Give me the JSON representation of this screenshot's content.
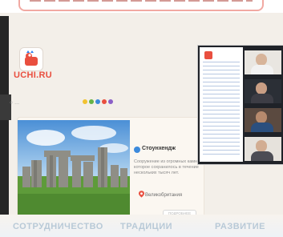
{
  "brand": {
    "name": "UCHI.RU",
    "color": "#e94f3f"
  },
  "header": {
    "left_faint": "○ ..."
  },
  "card": {
    "title": "Стоунхендж",
    "description": "Сооружение из огромных камней, которое сохранилось в течение нескольких тысяч лет.",
    "location": "Великобритания",
    "button": "ПОДРОБНЕЕ",
    "location_icon": "pin-icon"
  },
  "bottom_banner": {
    "words": [
      "СОТРУДНИЧЕСТВО",
      "ТРАДИЦИИ",
      "РАЗВИТИЕ"
    ]
  },
  "video_call": {
    "participants": 4
  },
  "colors": {
    "accent": "#e94f3f",
    "dots": [
      "#f2c230",
      "#65b347",
      "#3c8adc",
      "#e94f3f",
      "#8b5fc7"
    ]
  }
}
